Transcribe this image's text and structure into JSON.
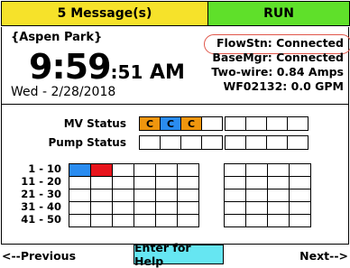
{
  "colors": {
    "message_bar": "#f6e22a",
    "run_bar": "#5fe02a",
    "help_button": "#66e6f2",
    "valve_active": "#f0960e",
    "station_blue": "#2a8cf0",
    "station_red": "#e8141c",
    "highlight_ring": "#e0564a"
  },
  "header": {
    "messages_label": "5 Message(s)",
    "mode_label": "RUN"
  },
  "info": {
    "site_name": "{Aspen Park}",
    "time_hm": "9:59",
    "time_sec": ":51",
    "time_ampm": " AM",
    "date": "Wed - 2/28/2018",
    "status_lines": [
      "FlowStn: Connected",
      "BaseMgr: Connected",
      "Two-wire:  0.84 Amps",
      "WF02132: 0.0 GPM"
    ]
  },
  "mv_status": {
    "label": "MV Status",
    "cells": [
      "C",
      "C",
      "C",
      "",
      "",
      "",
      "",
      ""
    ],
    "cell_colors": [
      "valve_active",
      "station_blue",
      "valve_active",
      "",
      "",
      "",
      "",
      ""
    ]
  },
  "pump_status": {
    "label": "Pump Status"
  },
  "station_rows": [
    {
      "label": "1 - 10"
    },
    {
      "label": "11 - 20"
    },
    {
      "label": "21 - 30"
    },
    {
      "label": "31 - 40"
    },
    {
      "label": "41 - 50"
    }
  ],
  "active_stations": [
    {
      "station": 1,
      "color": "station_blue"
    },
    {
      "station": 2,
      "color": "station_red"
    }
  ],
  "footer": {
    "previous_label": "<--Previous",
    "help_label": "Enter for Help",
    "next_label": "Next-->"
  }
}
